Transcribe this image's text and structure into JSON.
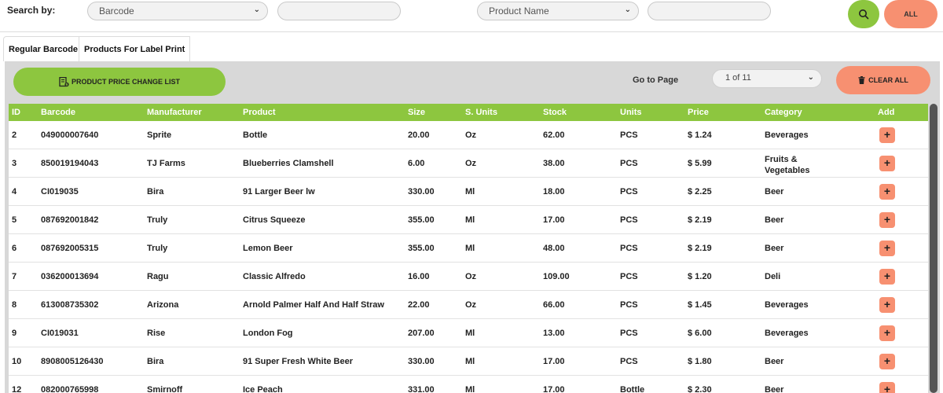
{
  "search": {
    "label": "Search by:",
    "filter1": "Barcode",
    "filter2": "Product Name",
    "all_label": "ALL",
    "icon": "search-icon"
  },
  "tabs": [
    {
      "label": "Regular Barcode",
      "active": true
    },
    {
      "label": "Products For Label Print",
      "active": false
    }
  ],
  "toolbar": {
    "price_change_label": "PRODUCT PRICE CHANGE LIST",
    "goto_label": "Go to Page",
    "page_value": "1 of 11",
    "clear_label": "CLEAR ALL"
  },
  "table": {
    "columns": [
      "ID",
      "Barcode",
      "Manufacturer",
      "Product",
      "Size",
      "S. Units",
      "Stock",
      "Units",
      "Price",
      "Category",
      "Add"
    ],
    "rows": [
      {
        "id": "2",
        "barcode": "049000007640",
        "manufacturer": "Sprite",
        "product": "Bottle",
        "size": "20.00",
        "sunits": "Oz",
        "stock": "62.00",
        "units": "PCS",
        "price": "$ 1.24",
        "category": "Beverages"
      },
      {
        "id": "3",
        "barcode": "850019194043",
        "manufacturer": "TJ Farms",
        "product": "Blueberries Clamshell",
        "size": "6.00",
        "sunits": "Oz",
        "stock": "38.00",
        "units": "PCS",
        "price": "$ 5.99",
        "category": "Fruits & Vegetables"
      },
      {
        "id": "4",
        "barcode": "CI019035",
        "manufacturer": "Bira",
        "product": "91 Larger Beer lw",
        "size": "330.00",
        "sunits": "Ml",
        "stock": "18.00",
        "units": "PCS",
        "price": "$ 2.25",
        "category": "Beer"
      },
      {
        "id": "5",
        "barcode": "087692001842",
        "manufacturer": "Truly",
        "product": "Citrus Squeeze",
        "size": "355.00",
        "sunits": "Ml",
        "stock": "17.00",
        "units": "PCS",
        "price": "$ 2.19",
        "category": "Beer"
      },
      {
        "id": "6",
        "barcode": "087692005315",
        "manufacturer": "Truly",
        "product": "Lemon Beer",
        "size": "355.00",
        "sunits": "Ml",
        "stock": "48.00",
        "units": "PCS",
        "price": "$ 2.19",
        "category": "Beer"
      },
      {
        "id": "7",
        "barcode": "036200013694",
        "manufacturer": "Ragu",
        "product": "Classic Alfredo",
        "size": "16.00",
        "sunits": "Oz",
        "stock": "109.00",
        "units": "PCS",
        "price": "$ 1.20",
        "category": "Deli"
      },
      {
        "id": "8",
        "barcode": "613008735302",
        "manufacturer": "Arizona",
        "product": "Arnold Palmer Half And Half Straw",
        "size": "22.00",
        "sunits": "Oz",
        "stock": "66.00",
        "units": "PCS",
        "price": "$ 1.45",
        "category": "Beverages"
      },
      {
        "id": "9",
        "barcode": "CI019031",
        "manufacturer": "Rise",
        "product": "London Fog",
        "size": "207.00",
        "sunits": "Ml",
        "stock": "13.00",
        "units": "PCS",
        "price": "$ 6.00",
        "category": "Beverages"
      },
      {
        "id": "10",
        "barcode": "8908005126430",
        "manufacturer": "Bira",
        "product": "91 Super Fresh White Beer",
        "size": "330.00",
        "sunits": "Ml",
        "stock": "17.00",
        "units": "PCS",
        "price": "$ 1.80",
        "category": "Beer"
      },
      {
        "id": "12",
        "barcode": "082000765998",
        "manufacturer": "Smirnoff",
        "product": "Ice Peach",
        "size": "331.00",
        "sunits": "Ml",
        "stock": "17.00",
        "units": "Bottle",
        "price": "$ 2.30",
        "category": "Beer"
      }
    ],
    "add_label": "+"
  },
  "colors": {
    "accent_green": "#8dc63f",
    "accent_salmon": "#f79071",
    "panel_gray": "#d8d8d8"
  }
}
